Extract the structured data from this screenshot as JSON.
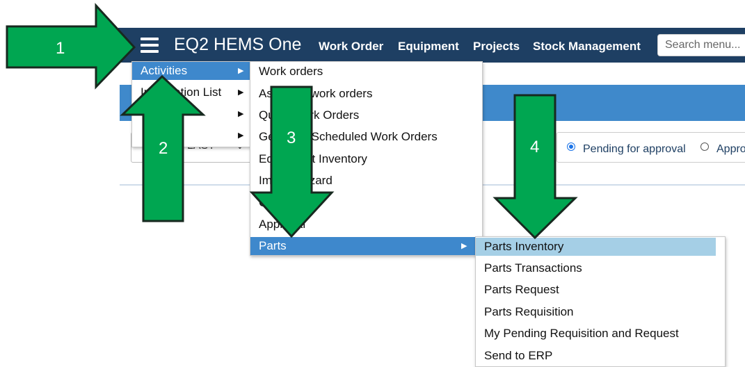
{
  "header": {
    "title": "EQ2 HEMS One",
    "nav": [
      "Work Order",
      "Equipment",
      "Projects",
      "Stock Management"
    ],
    "search_placeholder": "Search menu..."
  },
  "main_menu": {
    "items": [
      {
        "label": "Activities"
      },
      {
        "label": "Information List"
      },
      {
        "label": ""
      },
      {
        "label": ""
      }
    ]
  },
  "activities_menu": {
    "items": [
      "Work orders",
      "Assigned work orders",
      "Quick Work Orders",
      "Generate Scheduled Work Orders",
      "Equipment Inventory",
      "Import Wizard",
      "Checklist",
      "Approval",
      "Parts"
    ]
  },
  "parts_menu": {
    "items": [
      "Parts Inventory",
      "Parts Transactions",
      "Parts Request",
      "Parts Requisition",
      "My Pending Requisition and Request",
      "Send to ERP"
    ]
  },
  "filter": {
    "value": "LAST"
  },
  "approval_filter": {
    "options": [
      "Pending for approval",
      "Appro"
    ],
    "selected": 0
  },
  "callouts": [
    "1",
    "2",
    "3",
    "4"
  ],
  "colors": {
    "header_bg": "#1e3f63",
    "bar_blue": "#3f89cb",
    "menu_active": "#3e88cc",
    "menu_hover": "#a5cfe6",
    "arrow_green": "#00a651",
    "arrow_outline": "#17291f"
  }
}
